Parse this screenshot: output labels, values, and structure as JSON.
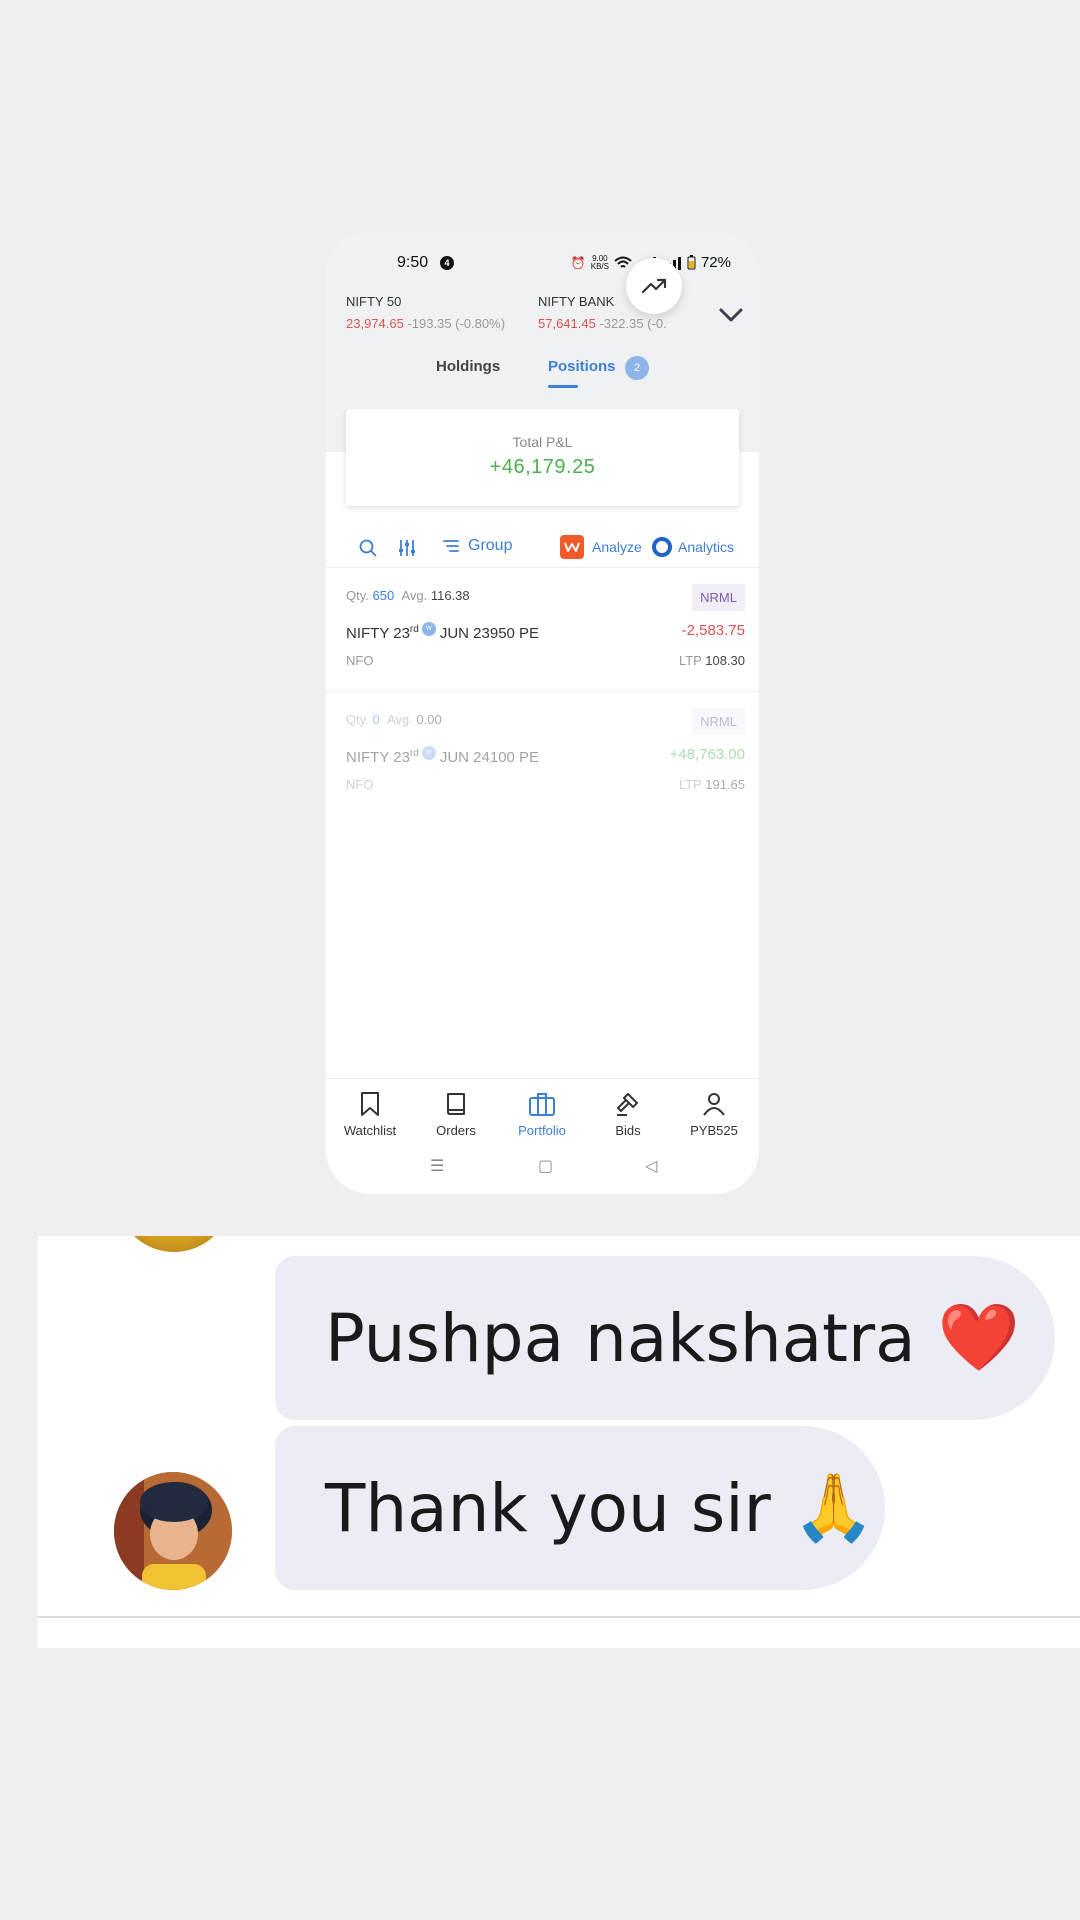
{
  "status_bar": {
    "time": "9:50",
    "notification_count": "4",
    "net_speed_top": "9.00",
    "net_speed_bottom": "KB/S",
    "battery": "72%"
  },
  "indices": [
    {
      "name": "NIFTY 50",
      "price": "23,974.65",
      "change": "-193.35 (-0.80%)"
    },
    {
      "name": "NIFTY BANK",
      "price": "57,641.45",
      "change": "-322.35 (-0."
    }
  ],
  "tabs": {
    "holdings": "Holdings",
    "positions": "Positions",
    "positions_count": "2"
  },
  "pnl": {
    "label": "Total P&L",
    "value": "+46,179.25"
  },
  "toolbar": {
    "group_label": "Group",
    "analyze_label": "Analyze",
    "analytics_label": "Analytics"
  },
  "positions": [
    {
      "qty_label": "Qty.",
      "qty": "650",
      "avg_label": "Avg.",
      "avg": "116.38",
      "product": "NRML",
      "symbol_prefix": "NIFTY 23",
      "symbol_sup": "rd",
      "weekly_badge": "W",
      "symbol_suffix": "JUN 23950 PE",
      "pnl": "-2,583.75",
      "exchange": "NFO",
      "ltp_label": "LTP",
      "ltp": "108.30"
    },
    {
      "qty_label": "Qty.",
      "qty": "0",
      "avg_label": "Avg.",
      "avg": "0.00",
      "product": "NRML",
      "symbol_prefix": "NIFTY 23",
      "symbol_sup": "rd",
      "weekly_badge": "W",
      "symbol_suffix": "JUN 24100 PE",
      "pnl": "+48,763.00",
      "exchange": "NFO",
      "ltp_label": "LTP",
      "ltp": "191.65"
    }
  ],
  "bottom_nav": {
    "items": [
      "Watchlist",
      "Orders",
      "Portfolio",
      "Bids",
      "PYB525"
    ],
    "active": "Portfolio"
  },
  "chat": {
    "messages": [
      {
        "text": "Pushpa nakshatra",
        "emoji": "❤️"
      },
      {
        "text": "Thank you sir",
        "emoji": "🙏"
      }
    ]
  },
  "colors": {
    "accent_blue": "#3c7fd8",
    "loss_red": "#d9534f",
    "profit_green": "#4caf50",
    "bubble_bg": "#ecedf4"
  }
}
